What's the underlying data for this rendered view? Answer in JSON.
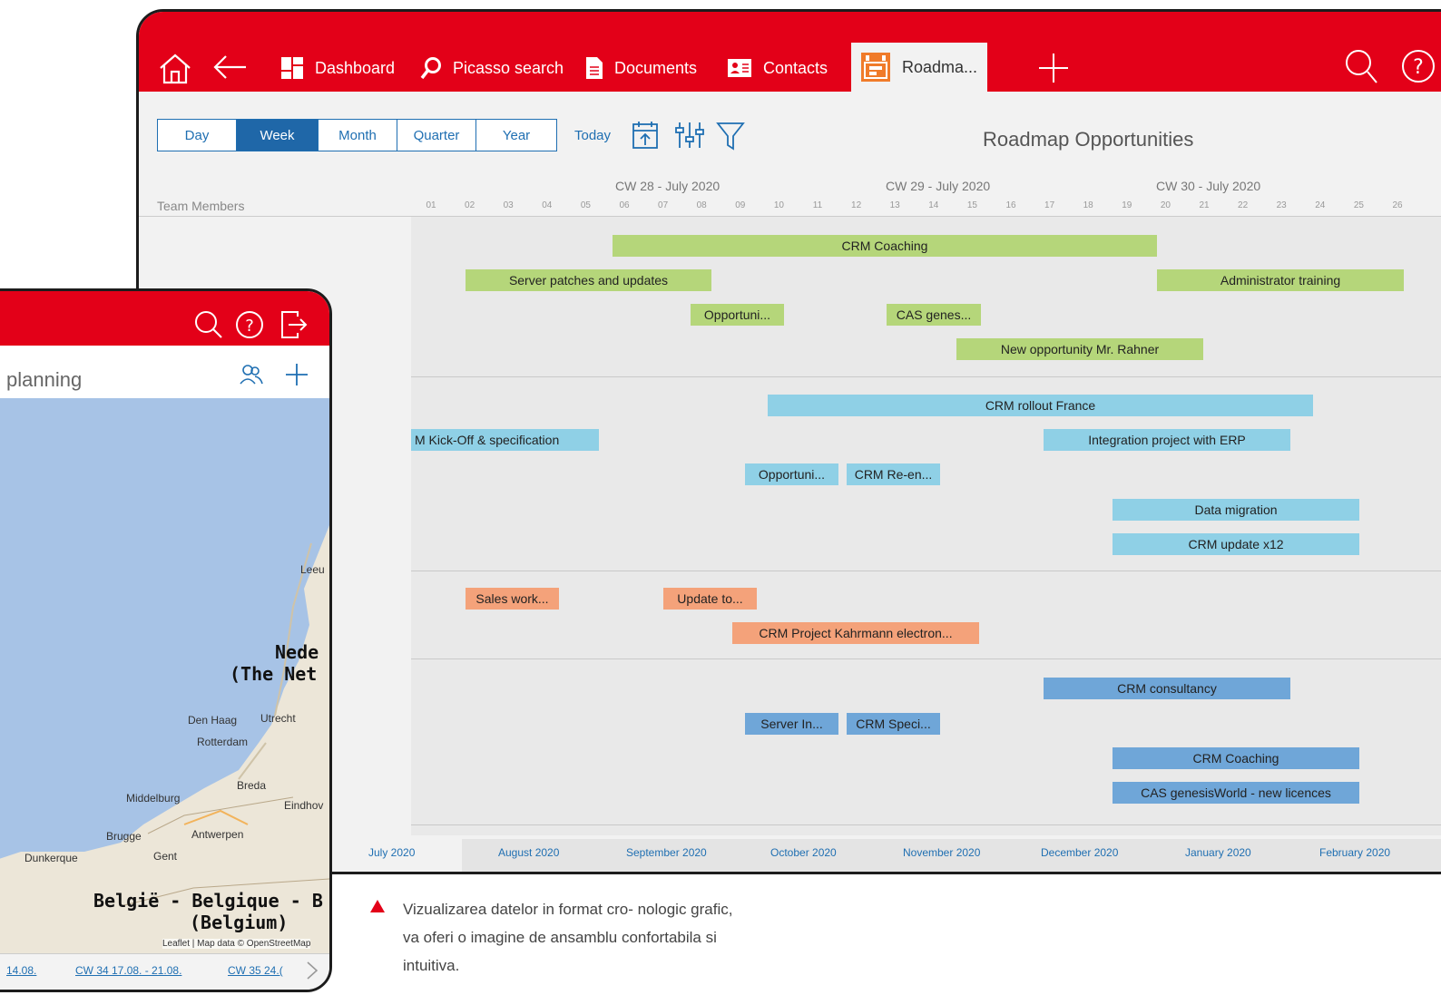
{
  "nav": {
    "tabs": [
      {
        "label": "Dashboard",
        "icon": "dashboard-icon"
      },
      {
        "label": "Picasso search",
        "icon": "search-icon"
      },
      {
        "label": "Documents",
        "icon": "document-icon"
      },
      {
        "label": "Contacts",
        "icon": "contact-card-icon"
      }
    ],
    "active_tab": "Roadma..."
  },
  "views": [
    "Day",
    "Week",
    "Month",
    "Quarter",
    "Year"
  ],
  "active_view": "Week",
  "today_label": "Today",
  "title": "Roadmap Opportunities",
  "team_members_label": "Team Members",
  "calendar_weeks": [
    "CW 28 - July 2020",
    "CW 29 - July 2020",
    "CW 30 - July 2020"
  ],
  "days": [
    "01",
    "02",
    "03",
    "04",
    "05",
    "06",
    "07",
    "08",
    "09",
    "10",
    "11",
    "12",
    "13",
    "14",
    "15",
    "16",
    "17",
    "18",
    "19",
    "20",
    "21",
    "22",
    "23",
    "24",
    "25",
    "26"
  ],
  "bars": [
    {
      "label": "CRM Coaching",
      "color": "#b5d67a"
    },
    {
      "label": "Server patches and updates",
      "color": "#b5d67a"
    },
    {
      "label": "Administrator training",
      "color": "#b5d67a"
    },
    {
      "label": "Opportuni...",
      "color": "#b5d67a"
    },
    {
      "label": "CAS genes...",
      "color": "#b5d67a"
    },
    {
      "label": "New opportunity Mr. Rahner",
      "color": "#b5d67a"
    },
    {
      "label": "CRM rollout France",
      "color": "#8fd0e6"
    },
    {
      "label": "M Kick-Off & specification",
      "color": "#8fd0e6"
    },
    {
      "label": "Integration project with ERP",
      "color": "#8fd0e6"
    },
    {
      "label": "Opportuni...",
      "color": "#8fd0e6"
    },
    {
      "label": "CRM Re-en...",
      "color": "#8fd0e6"
    },
    {
      "label": "Data migration",
      "color": "#8fd0e6"
    },
    {
      "label": "CRM update x12",
      "color": "#8fd0e6"
    },
    {
      "label": "Sales work...",
      "color": "#f4a27a"
    },
    {
      "label": "Update to...",
      "color": "#f4a27a"
    },
    {
      "label": "CRM Project Kahrmann electron...",
      "color": "#f4a27a"
    },
    {
      "label": "CRM consultancy",
      "color": "#6fa6d8"
    },
    {
      "label": "Server In...",
      "color": "#6fa6d8"
    },
    {
      "label": "CRM Speci...",
      "color": "#6fa6d8"
    },
    {
      "label": "CRM Coaching",
      "color": "#6fa6d8"
    },
    {
      "label": "CAS genesisWorld - new licences",
      "color": "#6fa6d8"
    }
  ],
  "months": [
    "July 2020",
    "August 2020",
    "September 2020",
    "October 2020",
    "November 2020",
    "December 2020",
    "January 2020",
    "February 2020"
  ],
  "phone": {
    "title": "planning",
    "map_labels": [
      "Leeu",
      "Nede",
      "(The Net",
      "Den Haag",
      "Utrecht",
      "Rotterdam",
      "Breda",
      "Middelburg",
      "Eindhov",
      "Brugge",
      "Antwerpen",
      "Gent",
      "Dunkerque",
      "België - Belgique - B",
      "(Belgium)",
      "Leaflet | Map data © OpenStreetMap"
    ],
    "cw_links": [
      "14.08.",
      "CW 34 17.08. - 21.08.",
      "CW 35 24.("
    ]
  },
  "caption": "Vizualizarea datelor in format cro- nologic grafic, va oferi o imagine de ansamblu confortabila si intuitiva.",
  "colors": {
    "brand": "#e30018",
    "accent": "#1f67a8"
  }
}
